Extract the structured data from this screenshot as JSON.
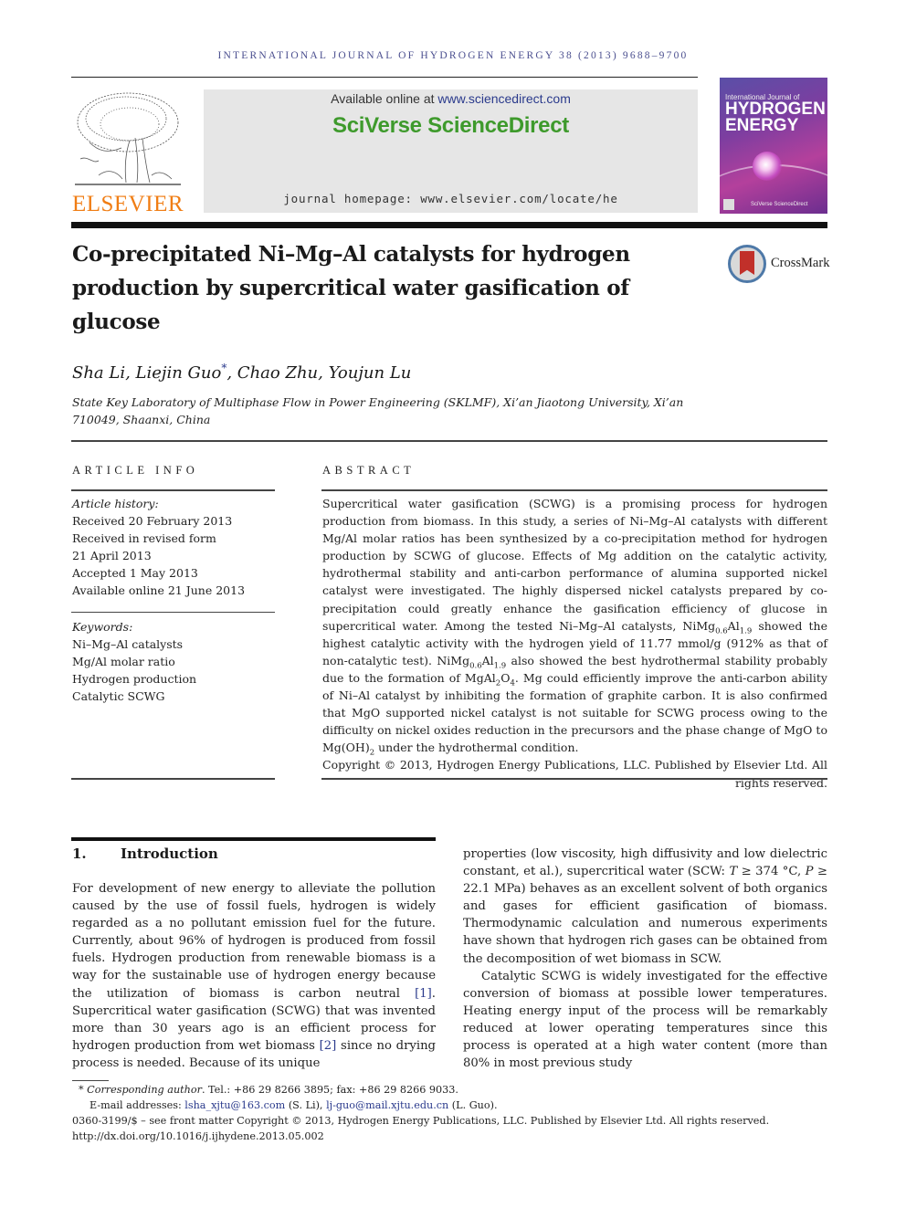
{
  "running_head": "INTERNATIONAL JOURNAL OF HYDROGEN ENERGY 38 (2013) 9688–9700",
  "header": {
    "publisher_logo_text": "ELSEVIER",
    "available_online_prefix": "Available online at ",
    "available_online_link": "www.sciencedirect.com",
    "brand": "SciVerse ScienceDirect",
    "homepage_label": "journal homepage: ",
    "homepage_url": "www.elsevier.com/locate/he",
    "cover": {
      "line1": "International Journal of",
      "line2": "HYDROGEN",
      "line3": "ENERGY",
      "footer": "SciVerse ScienceDirect"
    },
    "colors": {
      "elsevier_orange": "#f07d14",
      "sciencedirect_green": "#3e9a2c",
      "link_blue": "#2a3a8c"
    }
  },
  "article": {
    "title": "Co-precipitated Ni–Mg–Al catalysts for hydrogen production by supercritical water gasification of glucose",
    "crossmark_label": "CrossMark",
    "authors_prefix": "Sha Li, Liejin Guo",
    "authors_mark": "*",
    "authors_suffix": ", Chao Zhu, Youjun Lu",
    "affiliation": "State Key Laboratory of Multiphase Flow in Power Engineering (SKLMF), Xi’an Jiaotong University, Xi’an 710049, Shaanxi, China"
  },
  "article_info": {
    "label": "ARTICLE INFO",
    "history_label": "Article history:",
    "history": [
      "Received 20 February 2013",
      "Received in revised form",
      "21 April 2013",
      "Accepted 1 May 2013",
      "Available online 21 June 2013"
    ],
    "keywords_label": "Keywords:",
    "keywords": [
      "Ni–Mg–Al catalysts",
      "Mg/Al molar ratio",
      "Hydrogen production",
      "Catalytic SCWG"
    ]
  },
  "abstract": {
    "label": "ABSTRACT",
    "p1": "Supercritical water gasification (SCWG) is a promising process for hydrogen production from biomass. In this study, a series of Ni–Mg–Al catalysts with different Mg/Al molar ratios has been synthesized by a co-precipitation method for hydrogen production by SCWG of glucose. Effects of Mg addition on the catalytic activity, hydrothermal stability and anti-carbon performance of alumina supported nickel catalyst were investigated. The highly dispersed nickel catalysts prepared by co-precipitation could greatly enhance the gasification efficiency of glucose in supercritical water. Among the tested Ni–Mg–Al catalysts, NiMg",
    "sub1a": "0.6",
    "p1b": "Al",
    "sub1b": "1.9",
    "p2": " showed the highest catalytic activity with the hydrogen yield of 11.77 mmol/g (912% as that of non-catalytic test). NiMg",
    "sub2a": "0.6",
    "p2b": "Al",
    "sub2b": "1.9",
    "p3": " also showed the best hydrothermal stability probably due to the formation of MgAl",
    "sub3a": "2",
    "p3b": "O",
    "sub3b": "4",
    "p4": ". Mg could efficiently improve the anti-carbon ability of Ni–Al catalyst by inhibiting the formation of graphite carbon. It is also confirmed that MgO supported nickel catalyst is not suitable for SCWG process owing to the difficulty on nickel oxides reduction in the precursors and the phase change of MgO to Mg(OH)",
    "sub4": "2",
    "p5": " under the hydrothermal condition.",
    "copyright": "Copyright © 2013, Hydrogen Energy Publications, LLC. Published by Elsevier Ltd. All rights reserved."
  },
  "introduction": {
    "number": "1.",
    "heading": "Introduction",
    "left_a": "For development of new energy to alleviate the pollution caused by the use of fossil fuels, hydrogen is widely regarded as a no pollutant emission fuel for the future. Currently, about 96% of hydrogen is produced from fossil fuels. Hydrogen production from renewable biomass is a way for the sustainable use of hydrogen energy because the utilization of biomass is carbon neutral ",
    "ref1": "[1]",
    "left_b": ". Supercritical water gasification (SCWG) that was invented more than 30 years ago is an efficient process for hydrogen production from wet biomass ",
    "ref2": "[2]",
    "left_c": " since no drying process is needed. Because of its unique",
    "right_a": "properties (low viscosity, high diffusivity and low dielectric constant, et al.), supercritical water (SCW: ",
    "right_T": "T",
    "right_b": " ≥ 374 °C, ",
    "right_P": "P",
    "right_c": " ≥ 22.1 MPa) behaves as an excellent solvent of both organics and gases for efficient gasification of biomass. Thermodynamic calculation and numerous experiments have shown that hydrogen rich gases can be obtained from the decomposition of wet biomass in SCW.",
    "right_p2": "Catalytic SCWG is widely investigated for the effective conversion of biomass at possible lower temperatures. Heating energy input of the process will be remarkably reduced at lower operating temperatures since this process is operated at a high water content (more than 80% in most previous study"
  },
  "footnotes": {
    "mark": "*",
    "corresponding_label": "Corresponding author",
    "contact": ". Tel.: +86 29 8266 3895; fax: +86 29 8266 9033.",
    "email_label": "E-mail addresses: ",
    "email1": "lsha_xjtu@163.com",
    "email1_owner": " (S. Li), ",
    "email2": "lj-guo@mail.xjtu.edu.cn",
    "email2_owner": " (L. Guo).",
    "front_matter": "0360-3199/$ – see front matter Copyright © 2013, Hydrogen Energy Publications, LLC. Published by Elsevier Ltd. All rights reserved.",
    "doi": "http://dx.doi.org/10.1016/j.ijhydene.2013.05.002"
  }
}
